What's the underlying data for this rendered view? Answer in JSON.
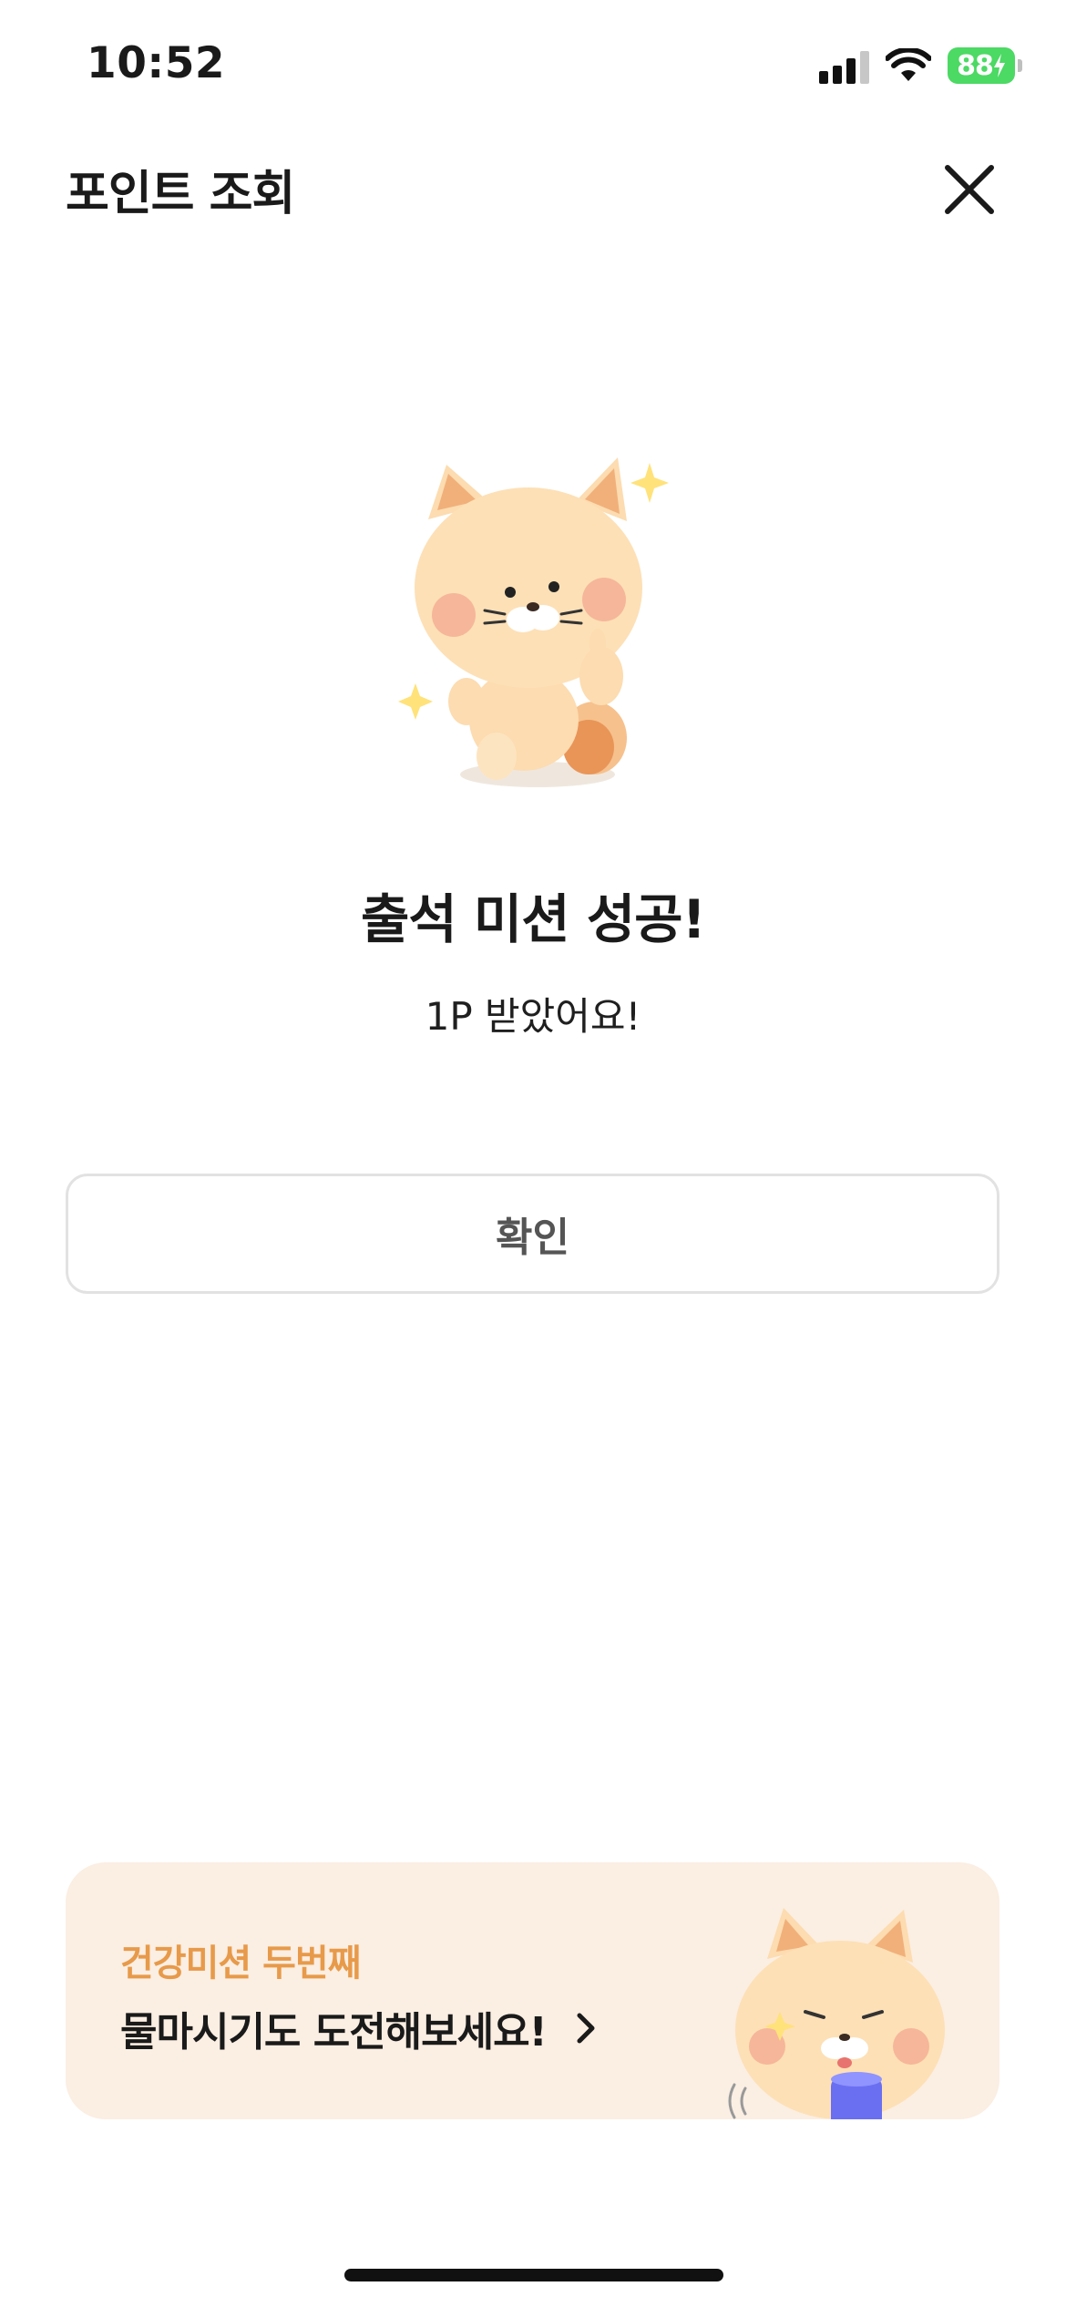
{
  "status_bar": {
    "time": "10:52",
    "battery": "88"
  },
  "header": {
    "title": "포인트 조회",
    "close_icon": "close-icon"
  },
  "result": {
    "title": "출석 미션 성공!",
    "subtitle": "1P 받았어요!"
  },
  "confirm_button": {
    "label": "확인"
  },
  "promo": {
    "subtitle": "건강미션 두번째",
    "title": "물마시기도 도전해보세요!",
    "chevron_icon": "chevron-right-icon"
  },
  "colors": {
    "accent_orange": "#e79a4a",
    "banner_bg": "#fbeee2",
    "battery_green": "#4cd964"
  }
}
